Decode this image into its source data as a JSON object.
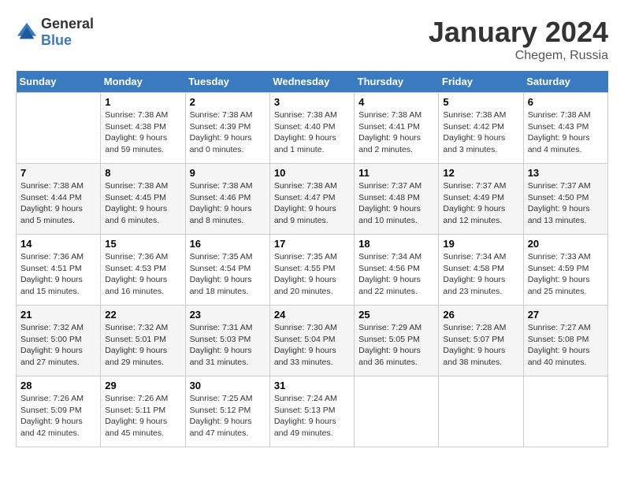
{
  "logo": {
    "general": "General",
    "blue": "Blue"
  },
  "header": {
    "month": "January 2024",
    "location": "Chegem, Russia"
  },
  "weekdays": [
    "Sunday",
    "Monday",
    "Tuesday",
    "Wednesday",
    "Thursday",
    "Friday",
    "Saturday"
  ],
  "weeks": [
    [
      {
        "day": "",
        "info": ""
      },
      {
        "day": "1",
        "info": "Sunrise: 7:38 AM\nSunset: 4:38 PM\nDaylight: 9 hours\nand 59 minutes."
      },
      {
        "day": "2",
        "info": "Sunrise: 7:38 AM\nSunset: 4:39 PM\nDaylight: 9 hours\nand 0 minutes."
      },
      {
        "day": "3",
        "info": "Sunrise: 7:38 AM\nSunset: 4:40 PM\nDaylight: 9 hours\nand 1 minute."
      },
      {
        "day": "4",
        "info": "Sunrise: 7:38 AM\nSunset: 4:41 PM\nDaylight: 9 hours\nand 2 minutes."
      },
      {
        "day": "5",
        "info": "Sunrise: 7:38 AM\nSunset: 4:42 PM\nDaylight: 9 hours\nand 3 minutes."
      },
      {
        "day": "6",
        "info": "Sunrise: 7:38 AM\nSunset: 4:43 PM\nDaylight: 9 hours\nand 4 minutes."
      }
    ],
    [
      {
        "day": "7",
        "info": "Sunrise: 7:38 AM\nSunset: 4:44 PM\nDaylight: 9 hours\nand 5 minutes."
      },
      {
        "day": "8",
        "info": "Sunrise: 7:38 AM\nSunset: 4:45 PM\nDaylight: 9 hours\nand 6 minutes."
      },
      {
        "day": "9",
        "info": "Sunrise: 7:38 AM\nSunset: 4:46 PM\nDaylight: 9 hours\nand 8 minutes."
      },
      {
        "day": "10",
        "info": "Sunrise: 7:38 AM\nSunset: 4:47 PM\nDaylight: 9 hours\nand 9 minutes."
      },
      {
        "day": "11",
        "info": "Sunrise: 7:37 AM\nSunset: 4:48 PM\nDaylight: 9 hours\nand 10 minutes."
      },
      {
        "day": "12",
        "info": "Sunrise: 7:37 AM\nSunset: 4:49 PM\nDaylight: 9 hours\nand 12 minutes."
      },
      {
        "day": "13",
        "info": "Sunrise: 7:37 AM\nSunset: 4:50 PM\nDaylight: 9 hours\nand 13 minutes."
      }
    ],
    [
      {
        "day": "14",
        "info": "Sunrise: 7:36 AM\nSunset: 4:51 PM\nDaylight: 9 hours\nand 15 minutes."
      },
      {
        "day": "15",
        "info": "Sunrise: 7:36 AM\nSunset: 4:53 PM\nDaylight: 9 hours\nand 16 minutes."
      },
      {
        "day": "16",
        "info": "Sunrise: 7:35 AM\nSunset: 4:54 PM\nDaylight: 9 hours\nand 18 minutes."
      },
      {
        "day": "17",
        "info": "Sunrise: 7:35 AM\nSunset: 4:55 PM\nDaylight: 9 hours\nand 20 minutes."
      },
      {
        "day": "18",
        "info": "Sunrise: 7:34 AM\nSunset: 4:56 PM\nDaylight: 9 hours\nand 22 minutes."
      },
      {
        "day": "19",
        "info": "Sunrise: 7:34 AM\nSunset: 4:58 PM\nDaylight: 9 hours\nand 23 minutes."
      },
      {
        "day": "20",
        "info": "Sunrise: 7:33 AM\nSunset: 4:59 PM\nDaylight: 9 hours\nand 25 minutes."
      }
    ],
    [
      {
        "day": "21",
        "info": "Sunrise: 7:32 AM\nSunset: 5:00 PM\nDaylight: 9 hours\nand 27 minutes."
      },
      {
        "day": "22",
        "info": "Sunrise: 7:32 AM\nSunset: 5:01 PM\nDaylight: 9 hours\nand 29 minutes."
      },
      {
        "day": "23",
        "info": "Sunrise: 7:31 AM\nSunset: 5:03 PM\nDaylight: 9 hours\nand 31 minutes."
      },
      {
        "day": "24",
        "info": "Sunrise: 7:30 AM\nSunset: 5:04 PM\nDaylight: 9 hours\nand 33 minutes."
      },
      {
        "day": "25",
        "info": "Sunrise: 7:29 AM\nSunset: 5:05 PM\nDaylight: 9 hours\nand 36 minutes."
      },
      {
        "day": "26",
        "info": "Sunrise: 7:28 AM\nSunset: 5:07 PM\nDaylight: 9 hours\nand 38 minutes."
      },
      {
        "day": "27",
        "info": "Sunrise: 7:27 AM\nSunset: 5:08 PM\nDaylight: 9 hours\nand 40 minutes."
      }
    ],
    [
      {
        "day": "28",
        "info": "Sunrise: 7:26 AM\nSunset: 5:09 PM\nDaylight: 9 hours\nand 42 minutes."
      },
      {
        "day": "29",
        "info": "Sunrise: 7:26 AM\nSunset: 5:11 PM\nDaylight: 9 hours\nand 45 minutes."
      },
      {
        "day": "30",
        "info": "Sunrise: 7:25 AM\nSunset: 5:12 PM\nDaylight: 9 hours\nand 47 minutes."
      },
      {
        "day": "31",
        "info": "Sunrise: 7:24 AM\nSunset: 5:13 PM\nDaylight: 9 hours\nand 49 minutes."
      },
      {
        "day": "",
        "info": ""
      },
      {
        "day": "",
        "info": ""
      },
      {
        "day": "",
        "info": ""
      }
    ]
  ]
}
